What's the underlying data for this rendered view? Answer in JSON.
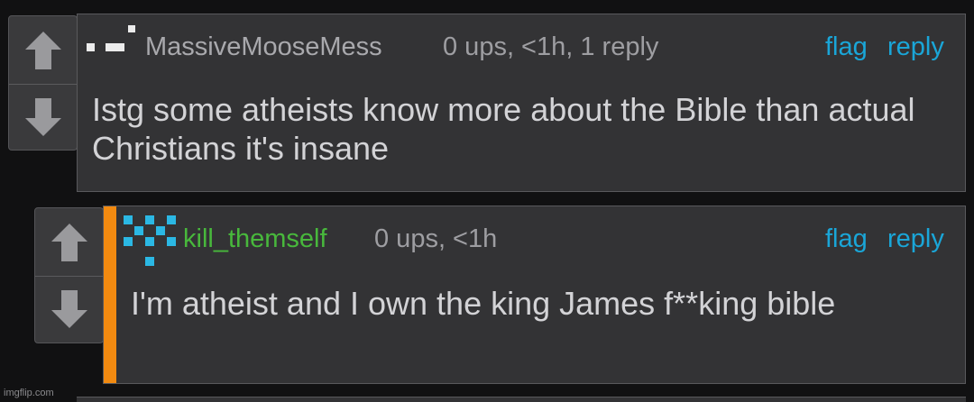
{
  "comments": [
    {
      "username": "MassiveMooseMess",
      "meta": "0 ups, <1h, 1 reply",
      "actions": {
        "flag": "flag",
        "reply": "reply"
      },
      "text": "Istg some atheists know more about the Bible than actual Christians it's insane",
      "username_color": "#a9a9ad"
    },
    {
      "username": "kill_themself",
      "meta": "0 ups, <1h",
      "actions": {
        "flag": "flag",
        "reply": "reply"
      },
      "text": "I'm atheist and I own the king James f**king bible",
      "username_color": "#48b83c",
      "accent_color": "#f28a10"
    }
  ],
  "watermark": "imgflip.com",
  "colors": {
    "link": "#1aa6d8",
    "background": "#111112"
  },
  "icons": {
    "upvote": "arrow-up-icon",
    "downvote": "arrow-down-icon"
  }
}
